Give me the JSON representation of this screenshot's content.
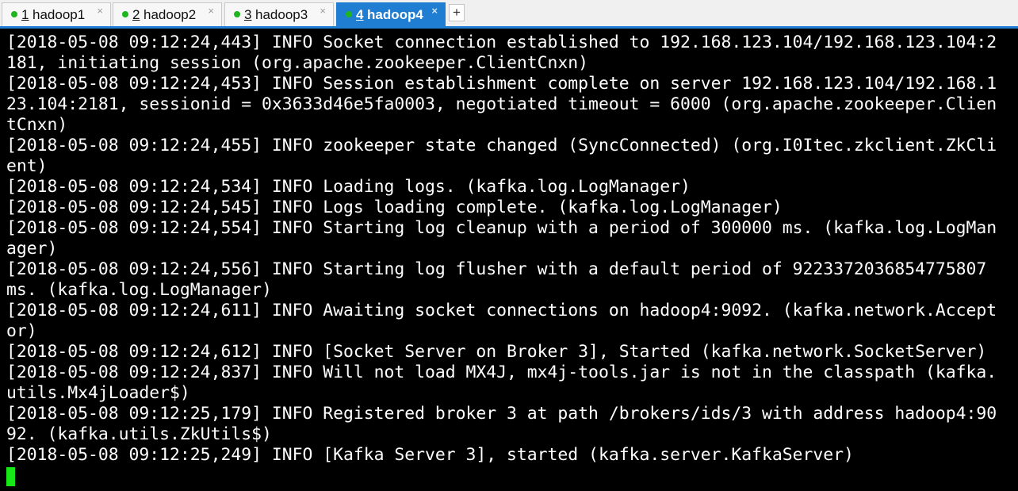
{
  "tabs": [
    {
      "num": "1",
      "name": "hadoop1",
      "close": "×"
    },
    {
      "num": "2",
      "name": "hadoop2",
      "close": "×"
    },
    {
      "num": "3",
      "name": "hadoop3",
      "close": "×"
    },
    {
      "num": "4",
      "name": "hadoop4",
      "close": "×"
    }
  ],
  "add_tab_label": "+",
  "colors": {
    "active_tab": "#1f7ed1",
    "status_dot": "#1fb51f",
    "terminal_bg": "#000000",
    "terminal_fg": "#ffffff",
    "cursor": "#17e617"
  },
  "terminal": {
    "lines": [
      "[2018-05-08 09:12:24,443] INFO Socket connection established to 192.168.123.104/192.168.123.104:2",
      "181, initiating session (org.apache.zookeeper.ClientCnxn)",
      "[2018-05-08 09:12:24,453] INFO Session establishment complete on server 192.168.123.104/192.168.1",
      "23.104:2181, sessionid = 0x3633d46e5fa0003, negotiated timeout = 6000 (org.apache.zookeeper.Clien",
      "tCnxn)",
      "[2018-05-08 09:12:24,455] INFO zookeeper state changed (SyncConnected) (org.I0Itec.zkclient.ZkCli",
      "ent)",
      "[2018-05-08 09:12:24,534] INFO Loading logs. (kafka.log.LogManager)",
      "[2018-05-08 09:12:24,545] INFO Logs loading complete. (kafka.log.LogManager)",
      "[2018-05-08 09:12:24,554] INFO Starting log cleanup with a period of 300000 ms. (kafka.log.LogMan",
      "ager)",
      "[2018-05-08 09:12:24,556] INFO Starting log flusher with a default period of 9223372036854775807",
      "ms. (kafka.log.LogManager)",
      "[2018-05-08 09:12:24,611] INFO Awaiting socket connections on hadoop4:9092. (kafka.network.Accept",
      "or)",
      "[2018-05-08 09:12:24,612] INFO [Socket Server on Broker 3], Started (kafka.network.SocketServer)",
      "[2018-05-08 09:12:24,837] INFO Will not load MX4J, mx4j-tools.jar is not in the classpath (kafka.",
      "utils.Mx4jLoader$)",
      "[2018-05-08 09:12:25,179] INFO Registered broker 3 at path /brokers/ids/3 with address hadoop4:90",
      "92. (kafka.utils.ZkUtils$)",
      "[2018-05-08 09:12:25,249] INFO [Kafka Server 3], started (kafka.server.KafkaServer)"
    ]
  }
}
